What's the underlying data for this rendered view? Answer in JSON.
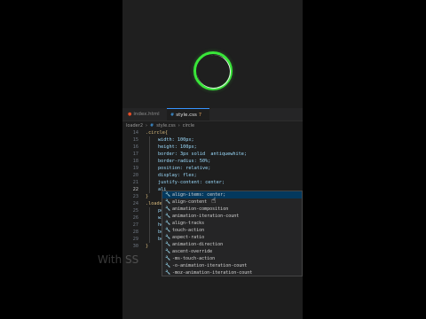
{
  "tabs": [
    {
      "label": "index.html",
      "active": false,
      "icon": "html-icon"
    },
    {
      "label": "style.css",
      "active": true,
      "icon": "css-icon",
      "badge": "7"
    }
  ],
  "breadcrumb": [
    "loader2",
    "style.css",
    "circle"
  ],
  "code_lines": [
    {
      "num": "14",
      "text": ".circle{"
    },
    {
      "num": "15",
      "text": "width: 100px;"
    },
    {
      "num": "16",
      "text": "height: 100px;"
    },
    {
      "num": "17",
      "text": "border: 3px solid  antiquewhite;"
    },
    {
      "num": "18",
      "text": "border-radius: 50%;"
    },
    {
      "num": "19",
      "text": "position: relative;"
    },
    {
      "num": "20",
      "text": "display: flex;"
    },
    {
      "num": "21",
      "text": "justify-content: center;"
    },
    {
      "num": "22",
      "text": "ali"
    },
    {
      "num": "23",
      "text": "}"
    },
    {
      "num": "24",
      "text": ".loader"
    },
    {
      "num": "25",
      "text": "pos"
    },
    {
      "num": "26",
      "text": "wid"
    },
    {
      "num": "27",
      "text": "hei"
    },
    {
      "num": "28",
      "text": "bor"
    },
    {
      "num": "29",
      "text": "bor"
    },
    {
      "num": "30",
      "text": "}"
    }
  ],
  "suggestions": [
    {
      "match": "ali",
      "rest": "gn-items: center;",
      "full": "align-items: center;"
    },
    {
      "match": "ali",
      "rest": "gn-content",
      "full": "align-content"
    },
    {
      "match": "",
      "rest": "",
      "full": "animation-composition"
    },
    {
      "match": "",
      "rest": "",
      "full": "animation-iteration-count"
    },
    {
      "match": "",
      "rest": "",
      "full": "align-tracks"
    },
    {
      "match": "",
      "rest": "",
      "full": "touch-action"
    },
    {
      "match": "",
      "rest": "",
      "full": "aspect-ratio"
    },
    {
      "match": "",
      "rest": "",
      "full": "animation-direction"
    },
    {
      "match": "",
      "rest": "",
      "full": "ascent-override"
    },
    {
      "match": "",
      "rest": "",
      "full": "-ms-touch-action"
    },
    {
      "match": "",
      "rest": "",
      "full": "-o-animation-iteration-count"
    },
    {
      "match": "",
      "rest": "",
      "full": "-moz-animation-iteration-count"
    }
  ],
  "watermark": "With SS",
  "colors": {
    "ring": "#39e639",
    "accent": "#3794ff",
    "highlight": "#04395e"
  }
}
